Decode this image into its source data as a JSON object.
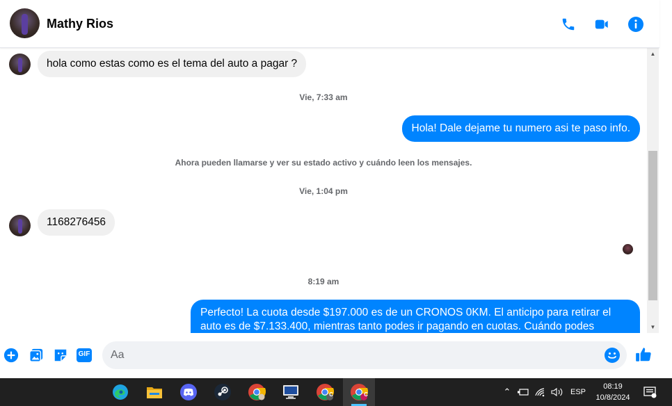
{
  "header": {
    "contact_name": "Mathy Rios",
    "actions": [
      "phone-icon",
      "video-call-icon",
      "info-icon"
    ],
    "accent_color": "#0084ff"
  },
  "messages": [
    {
      "type": "incoming",
      "text": "hola como estas como es el tema del auto a pagar ?"
    },
    {
      "type": "timestamp",
      "text": "Vie, 7:33 am"
    },
    {
      "type": "outgoing",
      "text": "Hola! Dale dejame tu numero  asi te paso info."
    },
    {
      "type": "system",
      "text": "Ahora pueden llamarse y ver su estado activo y cuándo leen los mensajes."
    },
    {
      "type": "timestamp",
      "text": "Vie, 1:04 pm"
    },
    {
      "type": "incoming",
      "text": "1168276456"
    },
    {
      "type": "timestamp",
      "text": "8:19 am"
    },
    {
      "type": "outgoing",
      "text": "Perfecto! La cuota desde $197.000 es de un CRONOS 0KM. El anticipo para retirar el auto es de $7.133.400, mientras tanto podes ir pagando en cuotas. Cuándo podes"
    }
  ],
  "composer": {
    "placeholder": "Aa",
    "icons": [
      "add-icon",
      "photo-icon",
      "sticker-icon",
      "gif-icon",
      "emoji-icon",
      "like-icon"
    ],
    "gif_label": "GIF"
  },
  "taskbar": {
    "apps": [
      "edge-icon",
      "file-explorer-icon",
      "discord-icon",
      "steam-icon",
      "chrome-icon",
      "remote-desktop-icon",
      "chrome-profile-c-icon",
      "chrome-profile-c-active-icon"
    ],
    "profile_letter": "C",
    "language": "ESP",
    "time": "08:19",
    "date": "10/8/2024"
  }
}
